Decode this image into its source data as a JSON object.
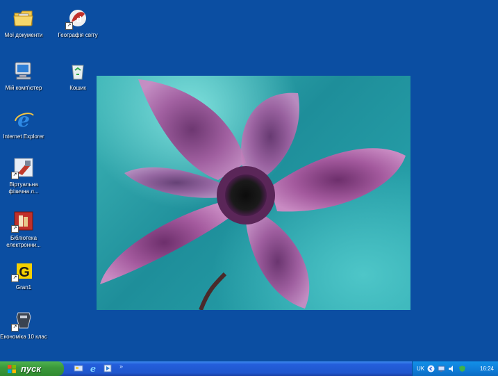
{
  "desktop": {
    "icons": [
      {
        "label": "Мої документи",
        "icon": "my-documents-icon"
      },
      {
        "label": "Географія світу",
        "icon": "world-geography-icon"
      },
      {
        "label": "Мій комп'ютер",
        "icon": "my-computer-icon"
      },
      {
        "label": "Кошик",
        "icon": "recycle-bin-icon"
      },
      {
        "label": "Internet Explorer",
        "icon": "internet-explorer-icon"
      },
      {
        "label": "Віртуальна фізична л...",
        "icon": "virtual-physics-lab-icon"
      },
      {
        "label": "Бібліотека електронни...",
        "icon": "electronic-library-icon"
      },
      {
        "label": "Gran1",
        "icon": "gran1-icon"
      },
      {
        "label": "Економіка 10 клас",
        "icon": "economics-10-icon"
      }
    ]
  },
  "taskbar": {
    "start_label": "пуск",
    "tray": {
      "language": "UK",
      "clock": "16:24"
    }
  },
  "colors": {
    "desktop_bg": "#0b4ea2",
    "taskbar": "#245edb",
    "start_button": "#3c9a3c",
    "tray": "#0f7fda"
  }
}
